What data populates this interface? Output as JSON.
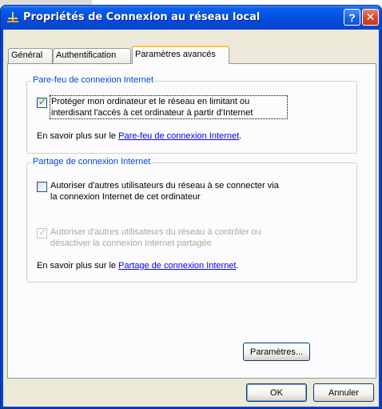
{
  "window": {
    "title": "Propriétés de Connexion au réseau local",
    "help_button": "?",
    "close_button": "✕"
  },
  "tabs": [
    {
      "label": "Général"
    },
    {
      "label": "Authentification"
    },
    {
      "label": "Paramètres avancés",
      "active": true
    }
  ],
  "firewall": {
    "legend": "Pare-feu de connexion Internet",
    "checkbox_line1": "Protéger mon ordinateur et le réseau en limitant ou",
    "checkbox_line2": "interdisant l'accès à cet ordinateur à partir d'Internet",
    "checked": true,
    "info_prefix": "En savoir plus sur le ",
    "info_link": "Pare-feu de connexion Internet",
    "info_suffix": "."
  },
  "sharing": {
    "legend": "Partage de connexion Internet",
    "allow_connect_line1": "Autoriser d'autres utilisateurs du réseau à se connecter via",
    "allow_connect_line2": "la connexion Internet de cet ordinateur",
    "allow_connect_checked": false,
    "allow_control_line1": "Autoriser d'autres utilisateurs du réseau à contrôler ou",
    "allow_control_line2": "désactiver la connexion Internet partagée",
    "allow_control_checked": true,
    "allow_control_disabled": true,
    "info_prefix": "En savoir plus sur le ",
    "info_link": "Partage de connexion Internet",
    "info_suffix": "."
  },
  "buttons": {
    "settings": "Paramètres...",
    "ok": "OK",
    "cancel": "Annuler"
  },
  "colors": {
    "titlebar": "#0554e3",
    "accent_legend": "#0046d5",
    "link": "#0000ff",
    "active_tab_highlight": "#ffc83c"
  }
}
